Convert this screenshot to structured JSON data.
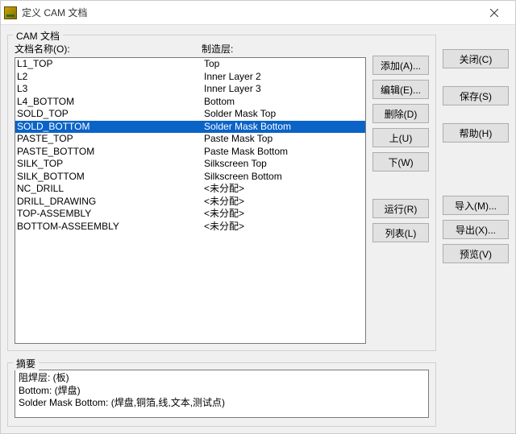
{
  "window": {
    "title": "定义 CAM 文档"
  },
  "group": {
    "cam_title": "CAM 文档",
    "summary_title": "摘要"
  },
  "headers": {
    "doc_name": "文档名称(O):",
    "layer": "制造层:"
  },
  "actions": {
    "add": "添加(A)...",
    "edit": "编辑(E)...",
    "delete": "删除(D)",
    "up": "上(U)",
    "down": "下(W)",
    "run": "运行(R)",
    "list": "列表(L)"
  },
  "side": {
    "close": "关闭(C)",
    "save": "保存(S)",
    "help": "帮助(H)",
    "import": "导入(M)...",
    "export": "导出(X)...",
    "preview": "预览(V)"
  },
  "rows": [
    {
      "name": "L1_TOP",
      "layer": "Top",
      "selected": false
    },
    {
      "name": "L2",
      "layer": "Inner Layer 2",
      "selected": false
    },
    {
      "name": "L3",
      "layer": "Inner Layer 3",
      "selected": false
    },
    {
      "name": "L4_BOTTOM",
      "layer": "Bottom",
      "selected": false
    },
    {
      "name": "SOLD_TOP",
      "layer": "Solder Mask Top",
      "selected": false
    },
    {
      "name": "SOLD_BOTTOM",
      "layer": "Solder Mask Bottom",
      "selected": true
    },
    {
      "name": "PASTE_TOP",
      "layer": "Paste Mask Top",
      "selected": false
    },
    {
      "name": "PASTE_BOTTOM",
      "layer": "Paste Mask Bottom",
      "selected": false
    },
    {
      "name": "SILK_TOP",
      "layer": "Silkscreen Top",
      "selected": false
    },
    {
      "name": "SILK_BOTTOM",
      "layer": "Silkscreen Bottom",
      "selected": false
    },
    {
      "name": "NC_DRILL",
      "layer": "<未分配>",
      "selected": false
    },
    {
      "name": "DRILL_DRAWING",
      "layer": "<未分配>",
      "selected": false
    },
    {
      "name": "TOP-ASSEMBLY",
      "layer": "<未分配>",
      "selected": false
    },
    {
      "name": "BOTTOM-ASSEEMBLY",
      "layer": "<未分配>",
      "selected": false
    }
  ],
  "summary": "阻焊层: (板)\nBottom: (焊盘)\nSolder Mask Bottom: (焊盘,铜箔,线,文本,测试点)"
}
